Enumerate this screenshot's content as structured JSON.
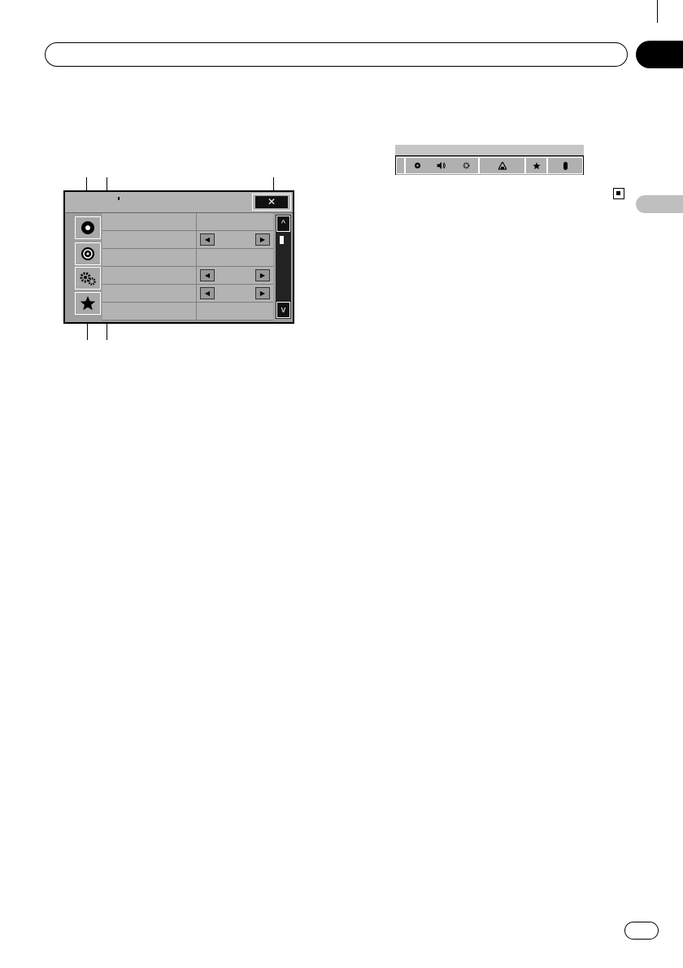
{
  "settings_screen": {
    "close_label": "✕",
    "scroll_up_label": "^",
    "scroll_down_label": "v",
    "arrow_left": "◀",
    "arrow_right": "▶",
    "side_icons": [
      "disc-icon",
      "source-icon",
      "settings-icon",
      "favorite-star-icon"
    ]
  },
  "bottom_bar": {
    "icons": [
      "disc-icon",
      "speaker-volume-icon",
      "settings-icon",
      "theme-icon",
      "favorite-star-icon",
      "bluetooth-icon"
    ]
  },
  "colors": {
    "screen_background": "#9e9e9e",
    "panel": "#b3b3b3",
    "section_tab": "#bfbfbf",
    "chapter_tab": "#000000"
  }
}
